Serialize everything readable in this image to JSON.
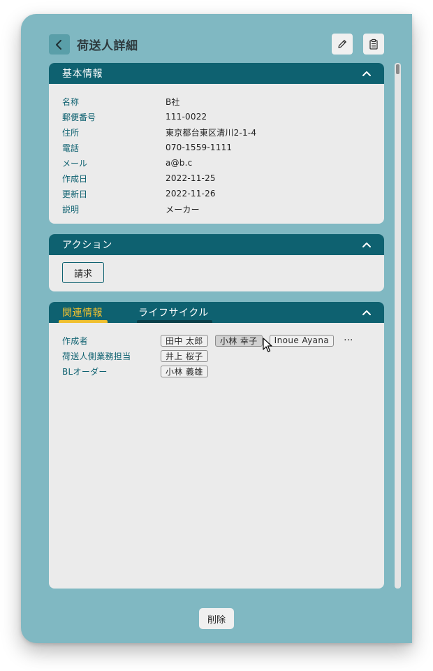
{
  "header": {
    "title": "荷送人詳細"
  },
  "colors": {
    "background": "#80b8c2",
    "header": "#0e6170",
    "accent": "#f0c030",
    "card": "#ebebeb"
  },
  "icons": {
    "back": "chevron-left-icon",
    "edit": "pencil-icon",
    "clipboard": "clipboard-icon",
    "collapse": "chevron-up-icon"
  },
  "basic_info": {
    "title": "基本情報",
    "rows": [
      {
        "label": "名称",
        "value": "B社"
      },
      {
        "label": "郵便番号",
        "value": "111-0022"
      },
      {
        "label": "住所",
        "value": "東京都台東区清川2-1-4"
      },
      {
        "label": "電話",
        "value": "070-1559-1111"
      },
      {
        "label": "メール",
        "value": "a@b.c"
      },
      {
        "label": "作成日",
        "value": "2022-11-25"
      },
      {
        "label": "更新日",
        "value": "2022-11-26"
      },
      {
        "label": "説明",
        "value": "メーカー"
      }
    ]
  },
  "actions": {
    "title": "アクション",
    "invoice_label": "請求"
  },
  "related": {
    "tabs": [
      {
        "label": "関連情報",
        "active": true
      },
      {
        "label": "ライフサイクル",
        "active": false
      }
    ],
    "rows": [
      {
        "label": "作成者",
        "chips": [
          "田中 太郎",
          "小林 幸子",
          "Inoue Ayana"
        ],
        "more": "···"
      },
      {
        "label": "荷送人側業務担当",
        "chips": [
          "井上 桜子"
        ]
      },
      {
        "label": "BLオーダー",
        "chips": [
          "小林 義雄"
        ]
      }
    ]
  },
  "footer": {
    "delete_label": "削除"
  }
}
